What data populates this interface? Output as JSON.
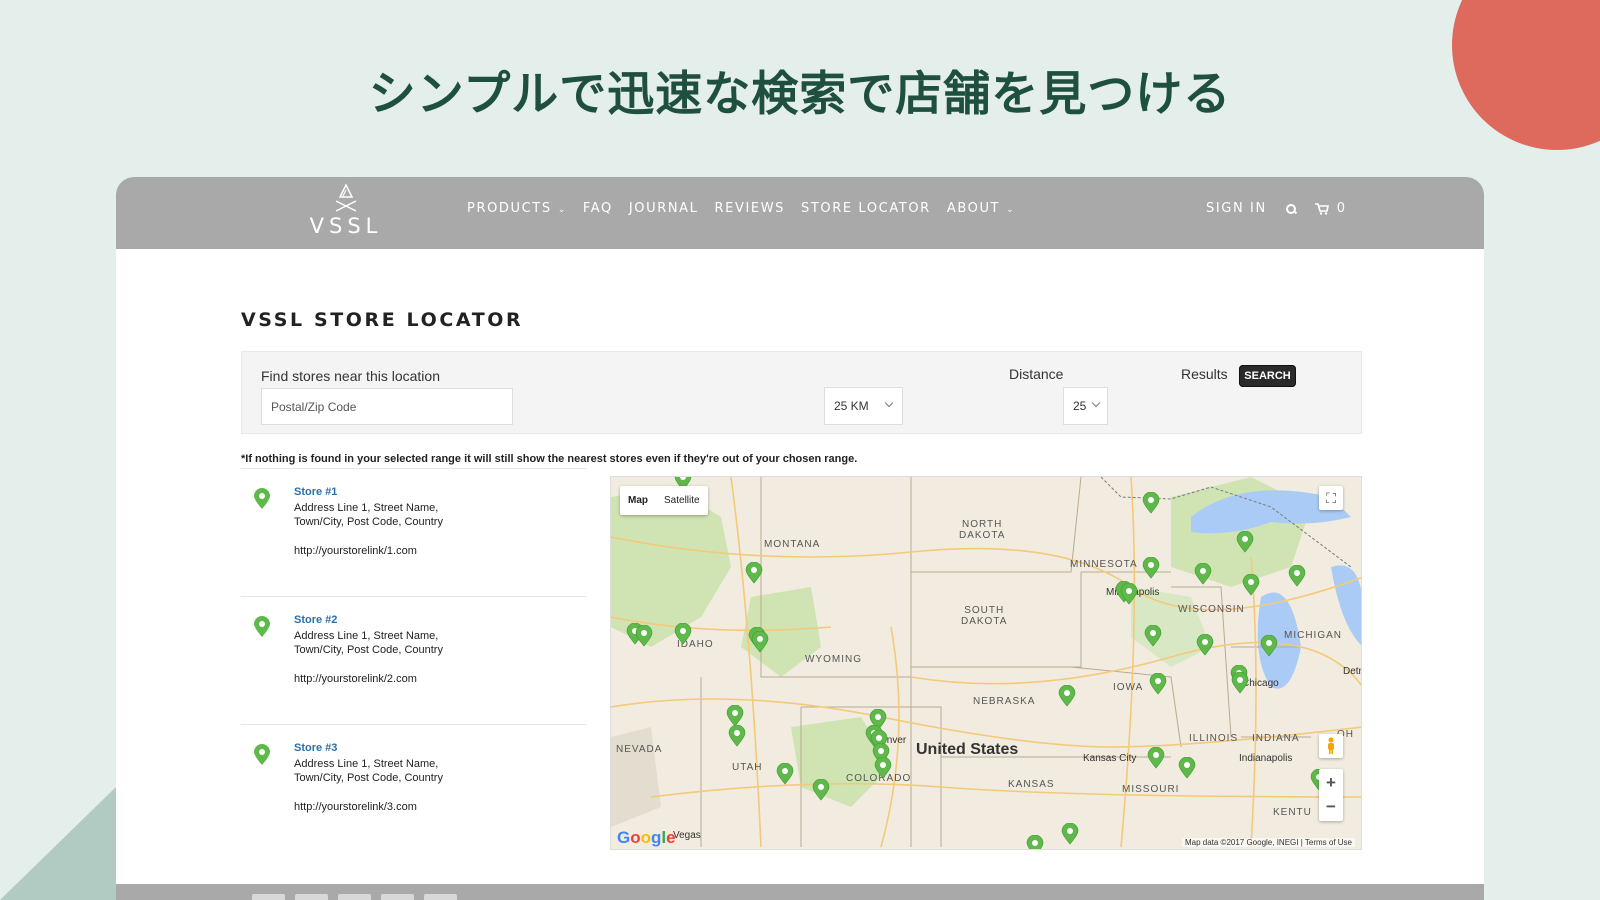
{
  "headline": "シンプルで迅速な検索で店舗を見つける",
  "colors": {
    "accent_circle": "#dd6a5d",
    "headline": "#1f4f3e",
    "nav_bg": "#a9a9a9",
    "pin_green": "#5fb84a"
  },
  "nav": {
    "logo_text": "VSSL",
    "items": [
      {
        "label": "PRODUCTS",
        "has_dropdown": true
      },
      {
        "label": "FAQ",
        "has_dropdown": false
      },
      {
        "label": "JOURNAL",
        "has_dropdown": false
      },
      {
        "label": "REVIEWS",
        "has_dropdown": false
      },
      {
        "label": "STORE LOCATOR",
        "has_dropdown": false
      },
      {
        "label": "ABOUT",
        "has_dropdown": true
      }
    ],
    "sign_in": "SIGN IN",
    "cart_count": "0",
    "search_icon": "search-icon",
    "cart_icon": "cart-icon"
  },
  "page_title": "VSSL STORE LOCATOR",
  "search": {
    "find_label": "Find stores near this location",
    "postal_placeholder": "Postal/Zip Code",
    "radius_value": "25 KM",
    "distance_label": "Distance",
    "results_label": "Results",
    "results_value": "25",
    "search_button": "SEARCH"
  },
  "notice": "*If nothing is found in your selected range it will still show the nearest stores even if they're out of your chosen range.",
  "stores": [
    {
      "name": "Store #1",
      "address1": "Address Line 1, Street Name,",
      "address2": "Town/City, Post Code, Country",
      "link": "http://yourstorelink/1.com"
    },
    {
      "name": "Store #2",
      "address1": "Address Line 1, Street Name,",
      "address2": "Town/City, Post Code, Country",
      "link": "http://yourstorelink/2.com"
    },
    {
      "name": "Store #3",
      "address1": "Address Line 1, Street Name,",
      "address2": "Town/City, Post Code, Country",
      "link": "http://yourstorelink/3.com"
    }
  ],
  "map": {
    "type_map": "Map",
    "type_satellite": "Satellite",
    "country_label": "United States",
    "states": {
      "north_dakota": "NORTH\nDAKOTA",
      "south_dakota": "SOUTH\nDAKOTA",
      "montana": "MONTANA",
      "minnesota": "MINNESOTA",
      "wisconsin": "WISCONSIN",
      "michigan": "MICHIGAN",
      "idaho": "IDAHO",
      "wyoming": "WYOMING",
      "nebraska": "NEBRASKA",
      "iowa": "IOWA",
      "illinois": "ILLINOIS",
      "indiana": "INDIANA",
      "nevada": "NEVADA",
      "utah": "UTAH",
      "colorado": "COLORADO",
      "kansas": "KANSAS",
      "missouri": "MISSOURI",
      "kentucky": "KENTU",
      "ohio": "OH"
    },
    "cities": {
      "minneapolis": "Minneapolis",
      "chicago": "Chicago",
      "detroit": "Detr",
      "denver": "Denver",
      "kansas_city": "Kansas City",
      "indianapolis": "Indianapolis",
      "las_vegas": "Vegas"
    },
    "google": "Google",
    "attribution": "Map data ©2017 Google, INEGI",
    "terms": "Terms of Use",
    "zoom_in": "+",
    "zoom_out": "−"
  }
}
